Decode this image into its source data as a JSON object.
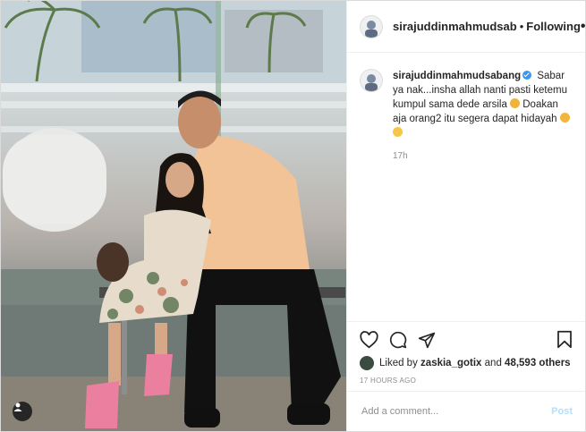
{
  "header": {
    "username": "sirajuddinmahmudsab",
    "separator": "•",
    "follow_status": "Following",
    "more_label": "•••"
  },
  "caption": {
    "username": "sirajuddinmahmudsabang",
    "text_part1": "Sabar ya nak...insha allah nanti pasti ketemu kumpul sama dede arsila",
    "text_part2": "Doakan aja orang2 itu segera dapat hidayah",
    "relative_time": "17h"
  },
  "icons": {
    "like": "heart-icon",
    "comment": "comment-icon",
    "share": "share-icon",
    "save": "bookmark-icon",
    "tagged_users": "user-icon",
    "more": "more-options-icon"
  },
  "likes": {
    "prefix": "Liked by",
    "user": "zaskia_gotix",
    "conjunction": "and",
    "others": "48,593 others"
  },
  "timestamp": "17 HOURS AGO",
  "comment": {
    "placeholder": "Add a comment...",
    "post_label": "Post"
  },
  "colors": {
    "accent": "#3897f0",
    "post_disabled": "#b2dffc",
    "muted_text": "#8e8e8e"
  }
}
